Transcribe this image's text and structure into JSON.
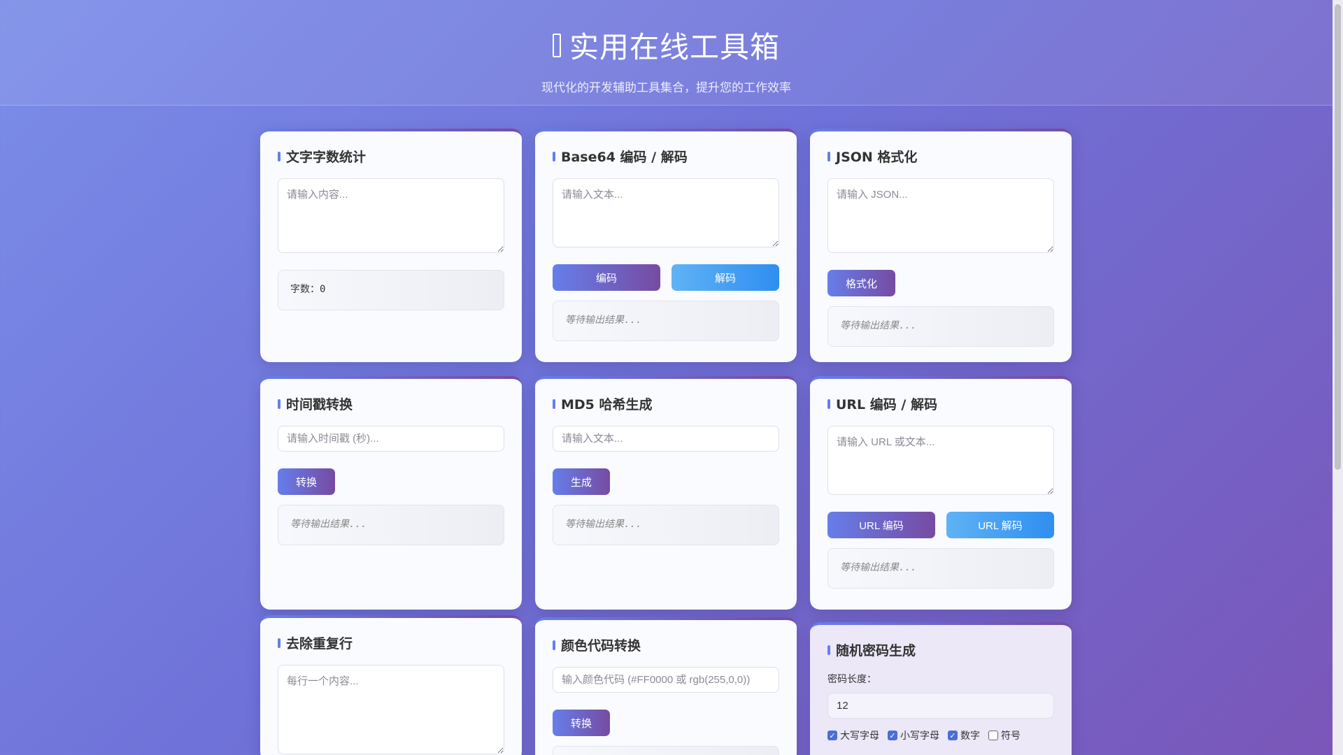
{
  "header": {
    "title": "实用在线工具箱",
    "subtitle": "现代化的开发辅助工具集合，提升您的工作效率"
  },
  "colors": {
    "accent_start": "#667eea",
    "accent_end": "#764ba2",
    "secondary": "#3a94f0"
  },
  "tools": {
    "wordcount": {
      "title": "文字字数统计",
      "placeholder": "请输入内容...",
      "count_label": "字数：",
      "count_value": "0"
    },
    "base64": {
      "title": "Base64 编码 / 解码",
      "placeholder": "请输入文本...",
      "encode": "编码",
      "decode": "解码",
      "output": "等待输出结果..."
    },
    "json": {
      "title": "JSON 格式化",
      "placeholder": "请输入 JSON...",
      "format": "格式化",
      "output": "等待输出结果..."
    },
    "timestamp": {
      "title": "时间戳转换",
      "placeholder": "请输入时间戳 (秒)...",
      "convert": "转换",
      "output": "等待输出结果..."
    },
    "md5": {
      "title": "MD5 哈希生成",
      "placeholder": "请输入文本...",
      "generate": "生成",
      "output": "等待输出结果..."
    },
    "url": {
      "title": "URL 编码 / 解码",
      "placeholder": "请输入 URL 或文本...",
      "encode": "URL 编码",
      "decode": "URL 解码",
      "output": "等待输出结果..."
    },
    "dedupe": {
      "title": "去除重复行",
      "placeholder": "每行一个内容..."
    },
    "color": {
      "title": "颜色代码转换",
      "placeholder": "输入颜色代码 (#FF0000 或 rgb(255,0,0))",
      "convert": "转换"
    },
    "password": {
      "title": "随机密码生成",
      "length_label": "密码长度：",
      "length_value": "12",
      "options": [
        {
          "label": "大写字母",
          "checked": true
        },
        {
          "label": "小写字母",
          "checked": true
        },
        {
          "label": "数字",
          "checked": true
        },
        {
          "label": "符号",
          "checked": false
        }
      ]
    }
  }
}
